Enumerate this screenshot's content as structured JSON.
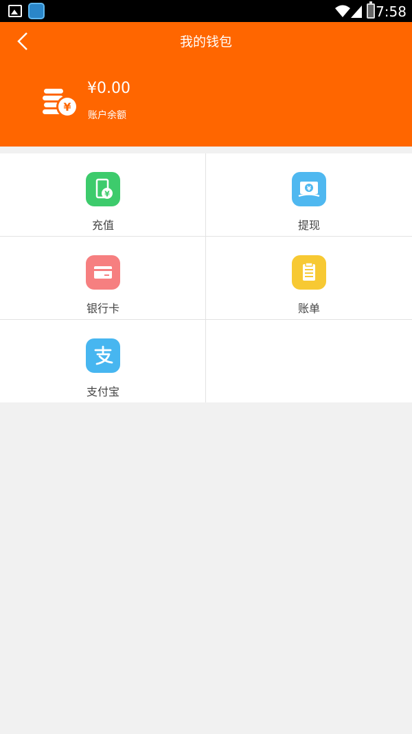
{
  "status_bar": {
    "time": "7:58",
    "icons": [
      "gallery-icon",
      "app-notification-icon",
      "wifi-icon",
      "signal-icon",
      "battery-icon"
    ]
  },
  "header": {
    "title": "我的钱包",
    "back_icon": "chevron-left-icon",
    "balance_amount": "¥0.00",
    "balance_label": "账户余额",
    "background": "#ff6600"
  },
  "grid": {
    "items": [
      {
        "label": "充值",
        "icon": "phone-recharge-icon",
        "color": "#3dcb6c"
      },
      {
        "label": "提现",
        "icon": "cash-withdraw-icon",
        "color": "#4fb8f0"
      },
      {
        "label": "银行卡",
        "icon": "bank-card-icon",
        "color": "#f67f80"
      },
      {
        "label": "账单",
        "icon": "bill-icon",
        "color": "#f7c933"
      },
      {
        "label": "支付宝",
        "icon": "alipay-icon",
        "color": "#47b6f0"
      }
    ]
  }
}
